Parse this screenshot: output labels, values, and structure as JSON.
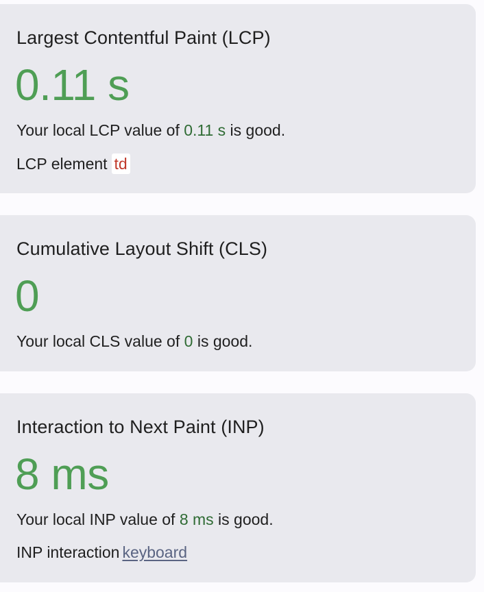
{
  "metrics": [
    {
      "title": "Largest Contentful Paint (LCP)",
      "value": "0.11 s",
      "summary_prefix": "Your local LCP value of ",
      "summary_value": "0.11 s",
      "summary_suffix": " is good.",
      "detail_label": "LCP element",
      "detail_value": "td"
    },
    {
      "title": "Cumulative Layout Shift (CLS)",
      "value": "0",
      "summary_prefix": "Your local CLS value of ",
      "summary_value": "0",
      "summary_suffix": " is good."
    },
    {
      "title": "Interaction to Next Paint (INP)",
      "value": "8 ms",
      "summary_prefix": "Your local INP value of ",
      "summary_value": "8 ms",
      "summary_suffix": " is good.",
      "detail_label": "INP interaction",
      "detail_value": "keyboard"
    }
  ],
  "colors": {
    "good_value": "#4f9e55",
    "good_text": "#2f6b34",
    "card_bg": "#e9e9ee",
    "code_text": "#c0392b",
    "link": "#5a6482"
  }
}
